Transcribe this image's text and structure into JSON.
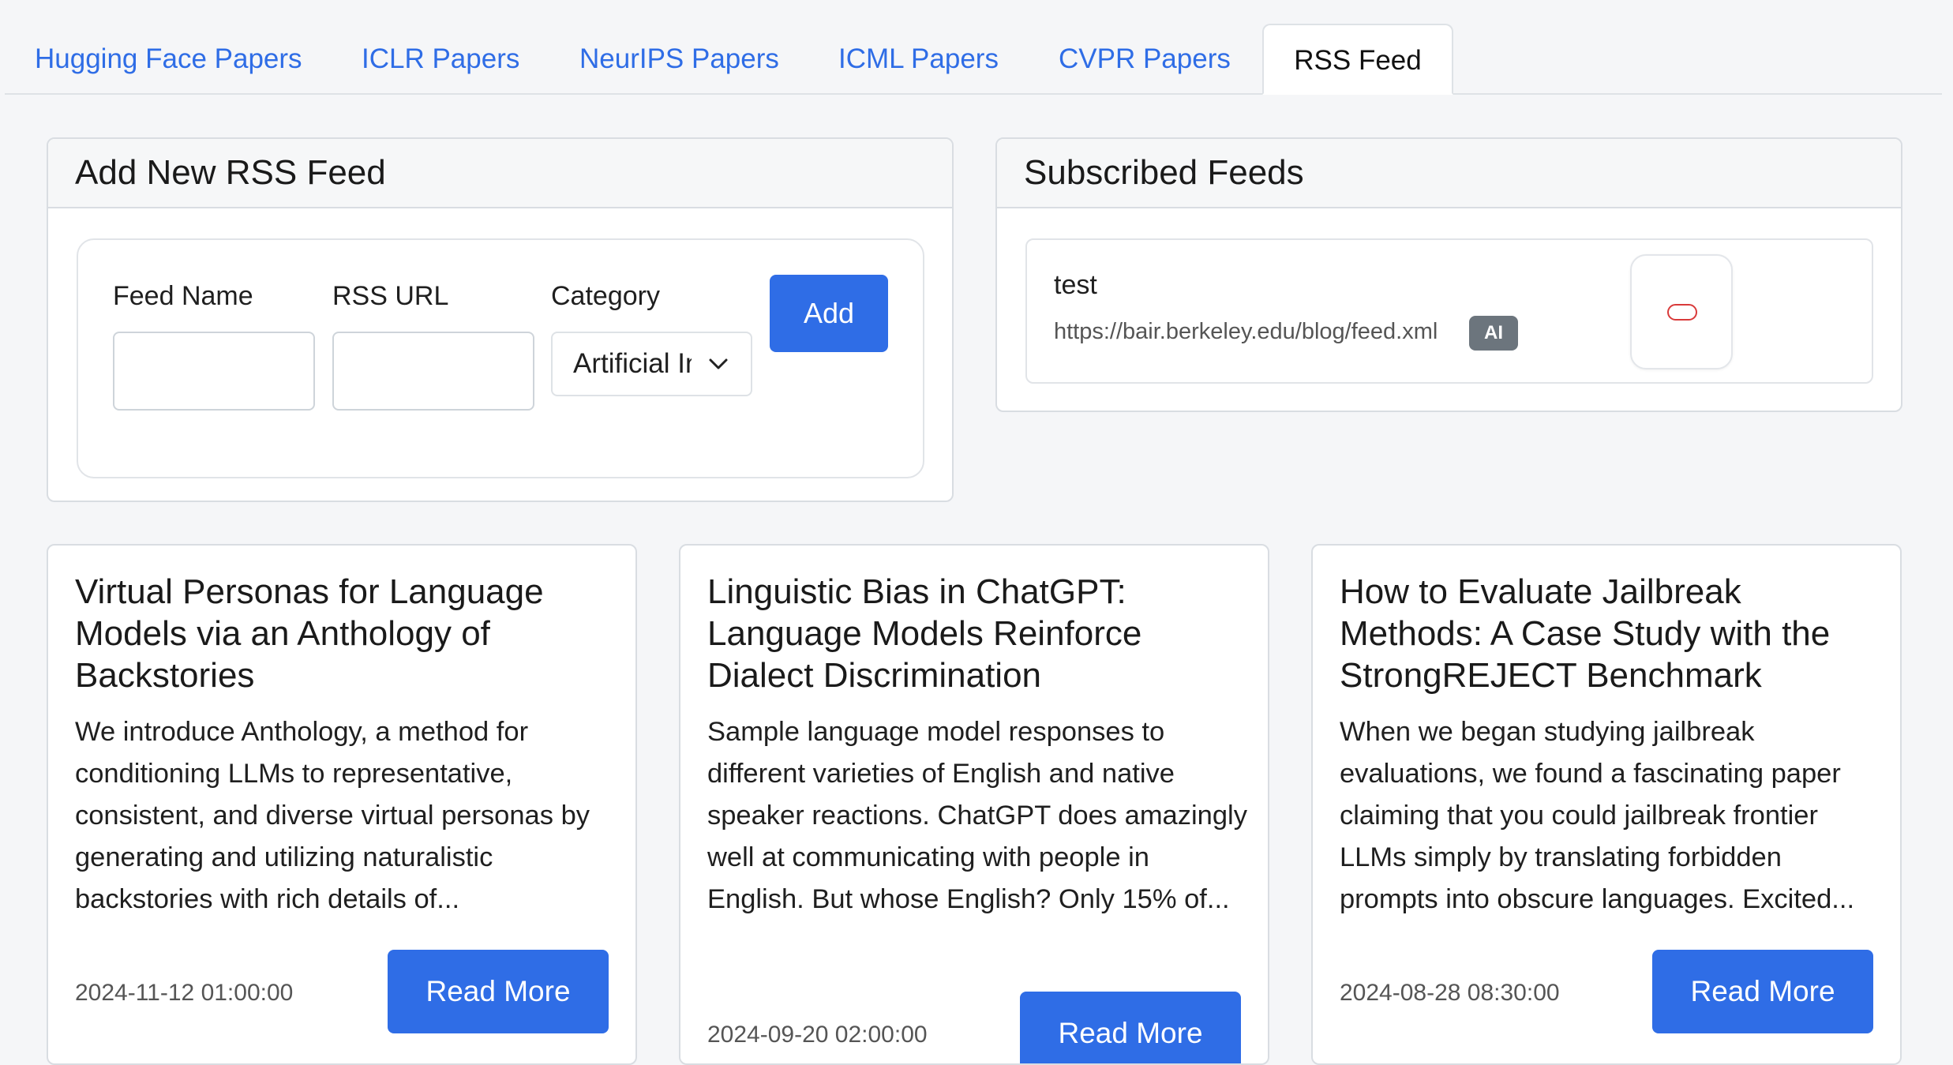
{
  "tabs": [
    {
      "label": "Hugging Face Papers",
      "active": false
    },
    {
      "label": "ICLR Papers",
      "active": false
    },
    {
      "label": "NeurIPS Papers",
      "active": false
    },
    {
      "label": "ICML Papers",
      "active": false
    },
    {
      "label": "CVPR Papers",
      "active": false
    },
    {
      "label": "RSS Feed",
      "active": true
    }
  ],
  "add_feed": {
    "title": "Add New RSS Feed",
    "feed_name_label": "Feed Name",
    "feed_name_value": "",
    "rss_url_label": "RSS URL",
    "rss_url_value": "",
    "category_label": "Category",
    "category_value": "Artificial Intelligence",
    "add_button": "Add"
  },
  "subscribed": {
    "title": "Subscribed Feeds",
    "feeds": [
      {
        "name": "test",
        "url": "https://bair.berkeley.edu/blog/feed.xml",
        "badge": "AI",
        "delete_icon": "trash-icon"
      }
    ]
  },
  "articles": [
    {
      "title": "Virtual Personas for Language Models via an Anthology of Backstories",
      "excerpt": "We introduce Anthology, a method for conditioning LLMs to representative, consistent, and diverse virtual personas by generating and utilizing naturalistic backstories with rich details of...",
      "date": "2024-11-12 01:00:00",
      "button": "Read More"
    },
    {
      "title": "Linguistic Bias in ChatGPT: Language Models Reinforce Dialect Discrimination",
      "excerpt": "Sample language model responses to different varieties of English and native speaker reactions. ChatGPT does amazingly well at communicating with people in English. But whose English? Only 15% of...",
      "date": "2024-09-20 02:00:00",
      "button": "Read More"
    },
    {
      "title": "How to Evaluate Jailbreak Methods: A Case Study with the StrongREJECT Benchmark",
      "excerpt": "When we began studying jailbreak evaluations, we found a fascinating paper claiming that you could jailbreak frontier LLMs simply by translating forbidden prompts into obscure languages. Excited...",
      "date": "2024-08-28 08:30:00",
      "button": "Read More"
    }
  ],
  "colors": {
    "accent": "#2f6de6",
    "badge": "#6c757d",
    "danger": "#d93a3a"
  }
}
